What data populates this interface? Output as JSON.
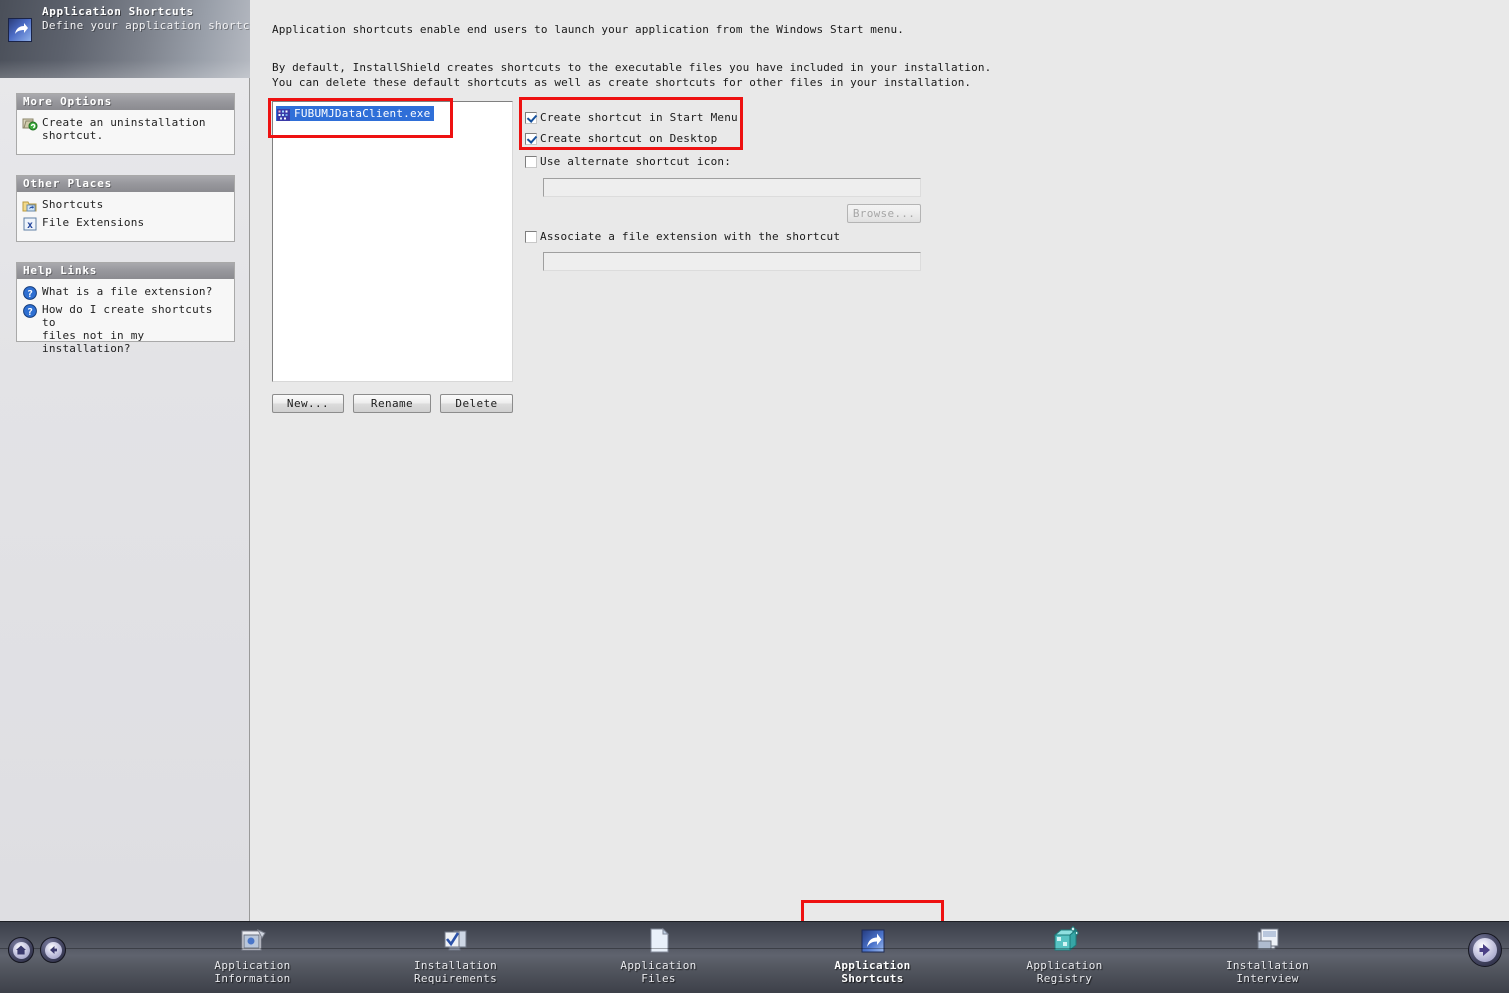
{
  "header": {
    "title": "Application Shortcuts",
    "subtitle": "Define your application shortcuts.",
    "icon": "shortcut-arrow-icon"
  },
  "sidebar": {
    "panels": [
      {
        "title": "More Options",
        "items": [
          {
            "label": "Create an uninstallation\nshortcut.",
            "icon": "uninstall-shortcut-icon"
          }
        ]
      },
      {
        "title": "Other Places",
        "items": [
          {
            "label": "Shortcuts",
            "icon": "folder-shortcut-icon"
          },
          {
            "label": "File Extensions",
            "icon": "file-extension-icon"
          }
        ]
      },
      {
        "title": "Help Links",
        "items": [
          {
            "label": "What is a file extension?",
            "icon": "help-question-icon"
          },
          {
            "label": "How do I create shortcuts to\nfiles not in my installation?",
            "icon": "help-question-icon"
          }
        ]
      }
    ]
  },
  "main": {
    "intro_line1": "Application shortcuts enable end users to launch your application from the Windows Start menu.",
    "intro_line2": "By default, InstallShield creates shortcuts to the executable files you have included in your installation.\nYou can delete these default shortcuts as well as create shortcuts for other files in your installation.",
    "shortcut_list": [
      {
        "name": "FUBUMJDataClient.exe",
        "selected": true,
        "icon": "executable-file-icon"
      }
    ],
    "buttons": {
      "new": "New...",
      "rename": "Rename",
      "delete": "Delete",
      "browse": "Browse..."
    },
    "options": [
      {
        "id": "start-menu",
        "label": "Create shortcut in Start Menu",
        "checked": true
      },
      {
        "id": "desktop",
        "label": "Create shortcut on Desktop",
        "checked": true
      },
      {
        "id": "alternate-icon",
        "label": "Use alternate shortcut icon:",
        "checked": false
      },
      {
        "id": "associate-ext",
        "label": "Associate a file extension with the shortcut",
        "checked": false
      }
    ],
    "fields": {
      "alternate_icon_value": "",
      "associate_extension_value": ""
    }
  },
  "bottom_nav": {
    "tabs": [
      {
        "label": "Application\nInformation",
        "icon": "application-information-icon",
        "active": false
      },
      {
        "label": "Installation\nRequirements",
        "icon": "installation-requirements-icon",
        "active": false
      },
      {
        "label": "Application\nFiles",
        "icon": "application-files-icon",
        "active": false
      },
      {
        "label": "Application\nShortcuts",
        "icon": "application-shortcuts-icon",
        "active": true
      },
      {
        "label": "Application\nRegistry",
        "icon": "application-registry-icon",
        "active": false
      },
      {
        "label": "Installation\nInterview",
        "icon": "installation-interview-icon",
        "active": false
      }
    ],
    "nav_buttons": [
      {
        "name": "home",
        "icon": "home-icon"
      },
      {
        "name": "back",
        "icon": "back-arrow-icon"
      },
      {
        "name": "next",
        "icon": "next-arrow-icon"
      }
    ]
  },
  "annotations": {
    "highlight_color": "#ee1111",
    "boxes": [
      "shortcut-list-item",
      "shortcut-checkboxes",
      "application-shortcuts-tab"
    ]
  }
}
